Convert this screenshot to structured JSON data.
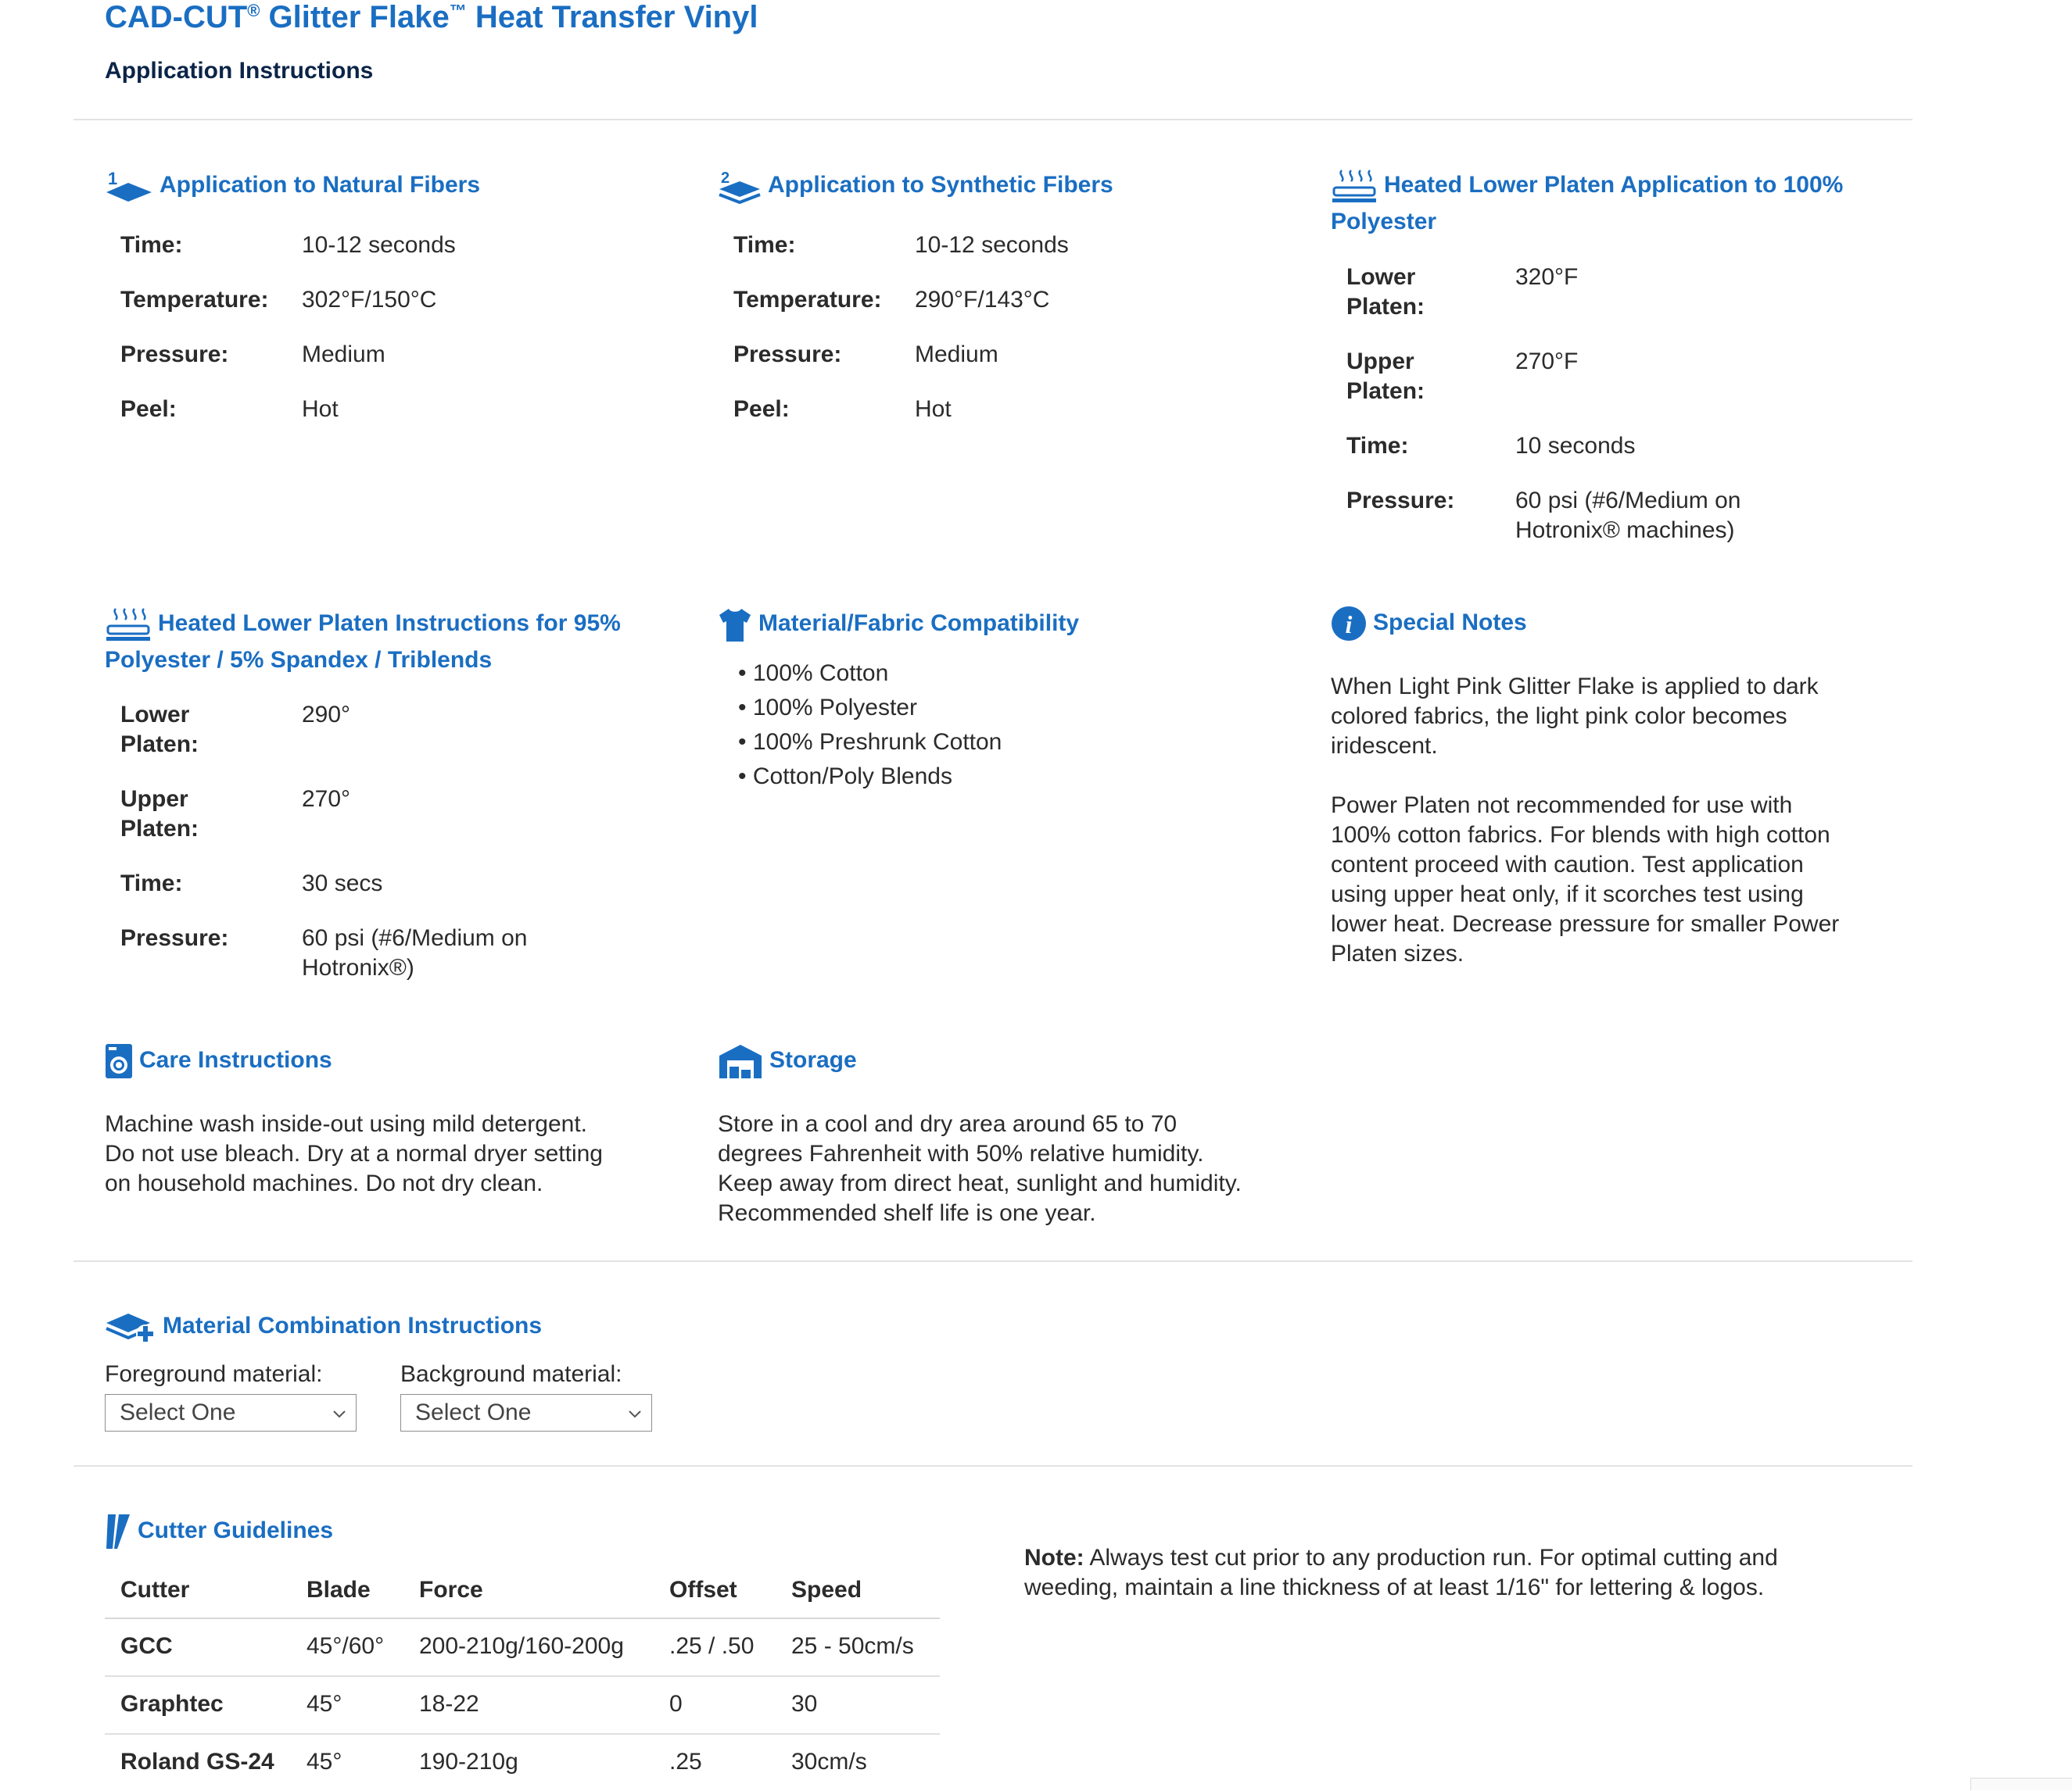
{
  "header": {
    "title_main": "CAD-CUT",
    "title_reg": "®",
    "title_mid": " Glitter Flake",
    "title_tm": "™",
    "title_end": " Heat Transfer Vinyl",
    "subtitle": "Application Instructions"
  },
  "natural": {
    "heading": "Application to Natural Fibers",
    "icon": "layer-1-icon",
    "rows": [
      {
        "label": "Time:",
        "value": "10-12 seconds"
      },
      {
        "label": "Temperature:",
        "value": "302°F/150°C"
      },
      {
        "label": "Pressure:",
        "value": "Medium"
      },
      {
        "label": "Peel:",
        "value": "Hot"
      }
    ]
  },
  "synthetic": {
    "heading": "Application to Synthetic Fibers",
    "icon": "layer-2-icon",
    "rows": [
      {
        "label": "Time:",
        "value": "10-12 seconds"
      },
      {
        "label": "Temperature:",
        "value": "290°F/143°C"
      },
      {
        "label": "Pressure:",
        "value": "Medium"
      },
      {
        "label": "Peel:",
        "value": "Hot"
      }
    ]
  },
  "heated_poly": {
    "heading_line1": "Heated Lower Platen Application to 100%",
    "heading_line2": "Polyester",
    "icon": "heat-platen-icon",
    "rows": [
      {
        "label1": "Lower",
        "label2": "Platen:",
        "value": "320°F"
      },
      {
        "label1": "Upper",
        "label2": "Platen:",
        "value": "270°F"
      },
      {
        "label1": "Time:",
        "label2": "",
        "value": "10 seconds"
      },
      {
        "label1": "Pressure:",
        "label2": "",
        "value": "60 psi (#6/Medium on",
        "value2": "Hotronix® machines)"
      }
    ]
  },
  "heated_blend": {
    "heading_line1": "Heated Lower Platen Instructions for 95%",
    "heading_line2": "Polyester / 5% Spandex / Triblends",
    "icon": "heat-platen-icon",
    "rows": [
      {
        "label1": "Lower",
        "label2": "Platen:",
        "value": "290°"
      },
      {
        "label1": "Upper",
        "label2": "Platen:",
        "value": "270°"
      },
      {
        "label1": "Time:",
        "label2": "",
        "value": "30 secs"
      },
      {
        "label1": "Pressure:",
        "label2": "",
        "value": "60 psi (#6/Medium on",
        "value2": "Hotronix®)"
      }
    ]
  },
  "compat": {
    "heading": "Material/Fabric Compatibility",
    "icon": "tshirt-icon",
    "items": [
      "100% Cotton",
      "100% Polyester",
      "100% Preshrunk Cotton",
      "Cotton/Poly Blends"
    ]
  },
  "notes": {
    "heading": "Special Notes",
    "icon": "info-icon",
    "p1": [
      "When Light Pink Glitter Flake is applied to dark",
      "colored fabrics, the light pink color becomes",
      "iridescent."
    ],
    "p2": [
      "Power Platen not recommended for use with",
      "100% cotton fabrics. For blends with high cotton",
      "content proceed with caution. Test application",
      "using upper heat only, if it scorches test using",
      "lower heat. Decrease pressure for smaller Power",
      "Platen sizes."
    ]
  },
  "care": {
    "heading": "Care Instructions",
    "icon": "washing-machine-icon",
    "lines": [
      "Machine wash inside-out using mild detergent.",
      "Do not use bleach. Dry at a normal dryer setting",
      "on household machines. Do not dry clean."
    ]
  },
  "storage": {
    "heading": "Storage",
    "icon": "warehouse-icon",
    "lines": [
      "Store in a cool and dry area around 65 to 70",
      "degrees Fahrenheit with 50% relative humidity.",
      "Keep away from direct heat, sunlight and humidity.",
      "Recommended shelf life is one year."
    ]
  },
  "combo": {
    "heading": "Material Combination Instructions",
    "icon": "layers-plus-icon",
    "fg_label": "Foreground material:",
    "fg_value": "Select One",
    "bg_label": "Background material:",
    "bg_value": "Select One"
  },
  "cutter": {
    "heading": "Cutter Guidelines",
    "icon": "blade-icon",
    "columns": [
      "Cutter",
      "Blade",
      "Force",
      "Offset",
      "Speed"
    ],
    "rows": [
      [
        "GCC",
        "45°/60°",
        "200-210g/160-200g",
        ".25 / .50",
        "25 - 50cm/s"
      ],
      [
        "Graphtec",
        "45°",
        "18-22",
        "0",
        "30"
      ],
      [
        "Roland GS-24",
        "45°",
        "190-210g",
        ".25",
        "30cm/s"
      ]
    ],
    "note_label": "Note:",
    "note_line1": " Always test cut prior to any production run. For optimal cutting and",
    "note_line2": "weeding, maintain a line thickness of at least 1/16\" for lettering & logos."
  },
  "colors": {
    "accent": "#1a6ec2",
    "heading_dark": "#0b2448",
    "text": "#2b2b2b"
  }
}
